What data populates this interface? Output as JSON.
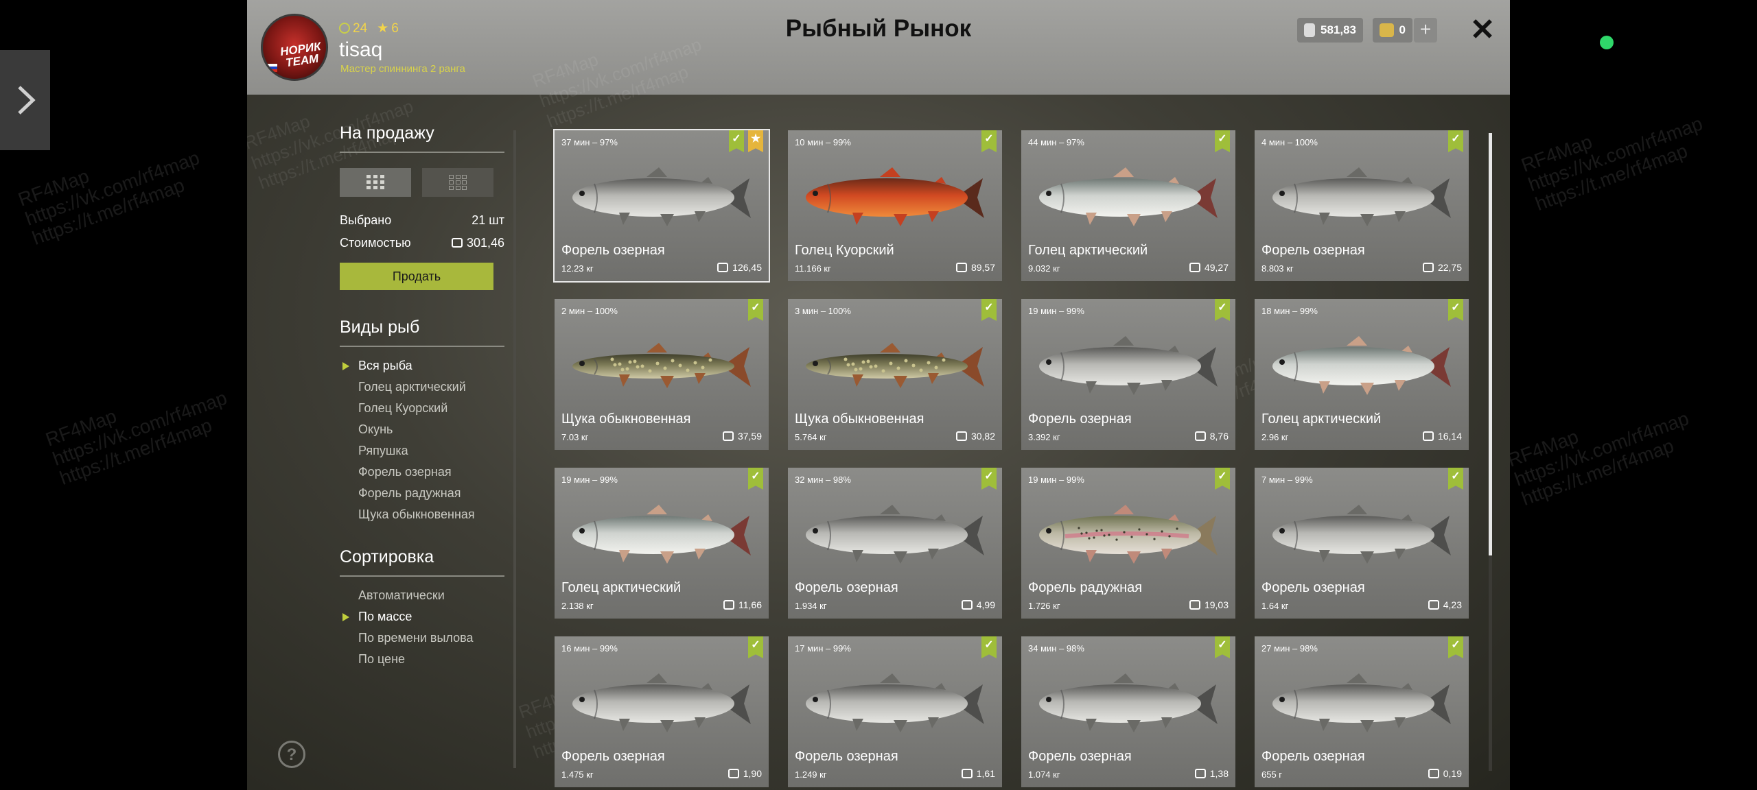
{
  "header": {
    "title": "Рыбный Рынок",
    "avatar_logo": "НОРИК TEAM",
    "stats": {
      "level": "24",
      "stars": "6"
    },
    "username": "tisaq",
    "rank": "Мастер спиннинга 2 ранга",
    "currency_silver": "581,83",
    "currency_gold": "0",
    "plus_label": "+",
    "close_label": "✕"
  },
  "sale": {
    "title": "На продажу",
    "selected_label": "Выбрано",
    "selected_value": "21 шт",
    "cost_label": "Стоимостью",
    "cost_value": "301,46",
    "sell_button": "Продать"
  },
  "species": {
    "title": "Виды рыб",
    "items": [
      "Вся рыба",
      "Голец арктический",
      "Голец Куорский",
      "Окунь",
      "Ряпушка",
      "Форель озерная",
      "Форель радужная",
      "Щука обыкновенная"
    ],
    "active_index": 0
  },
  "sorting": {
    "title": "Сортировка",
    "items": [
      "Автоматически",
      "По массе",
      "По времени вылова",
      "По цене"
    ],
    "active_index": 1
  },
  "help_label": "?",
  "watermarks": [
    "RF4Map",
    "https://vk.com/rf4map",
    "https://t.me/rf4map"
  ],
  "fish_cards": [
    {
      "time": "37 мин – 97%",
      "name": "Форель озерная",
      "weight": "12.23 кг",
      "price": "126,45",
      "kind": "trout",
      "selected": true,
      "favorite": true
    },
    {
      "time": "10 мин – 99%",
      "name": "Голец Куорский",
      "weight": "11.166 кг",
      "price": "89,57",
      "kind": "char_red",
      "selected": false,
      "favorite": false
    },
    {
      "time": "44 мин – 97%",
      "name": "Голец арктический",
      "weight": "9.032 кг",
      "price": "49,27",
      "kind": "char_arctic",
      "selected": false,
      "favorite": false
    },
    {
      "time": "4 мин – 100%",
      "name": "Форель озерная",
      "weight": "8.803 кг",
      "price": "22,75",
      "kind": "trout",
      "selected": false,
      "favorite": false
    },
    {
      "time": "2 мин – 100%",
      "name": "Щука обыкновенная",
      "weight": "7.03 кг",
      "price": "37,59",
      "kind": "pike",
      "selected": false,
      "favorite": false
    },
    {
      "time": "3 мин – 100%",
      "name": "Щука обыкновенная",
      "weight": "5.764 кг",
      "price": "30,82",
      "kind": "pike",
      "selected": false,
      "favorite": false
    },
    {
      "time": "19 мин – 99%",
      "name": "Форель озерная",
      "weight": "3.392 кг",
      "price": "8,76",
      "kind": "trout",
      "selected": false,
      "favorite": false
    },
    {
      "time": "18 мин – 99%",
      "name": "Голец арктический",
      "weight": "2.96 кг",
      "price": "16,14",
      "kind": "char_arctic",
      "selected": false,
      "favorite": false
    },
    {
      "time": "19 мин – 99%",
      "name": "Голец арктический",
      "weight": "2.138 кг",
      "price": "11,66",
      "kind": "char_arctic",
      "selected": false,
      "favorite": false
    },
    {
      "time": "32 мин – 98%",
      "name": "Форель озерная",
      "weight": "1.934 кг",
      "price": "4,99",
      "kind": "trout",
      "selected": false,
      "favorite": false
    },
    {
      "time": "19 мин – 99%",
      "name": "Форель радужная",
      "weight": "1.726 кг",
      "price": "19,03",
      "kind": "rainbow",
      "selected": false,
      "favorite": false
    },
    {
      "time": "7 мин – 99%",
      "name": "Форель озерная",
      "weight": "1.64 кг",
      "price": "4,23",
      "kind": "trout",
      "selected": false,
      "favorite": false
    },
    {
      "time": "16 мин – 99%",
      "name": "Форель озерная",
      "weight": "1.475 кг",
      "price": "1,90",
      "kind": "trout",
      "selected": false,
      "favorite": false
    },
    {
      "time": "17 мин – 99%",
      "name": "Форель озерная",
      "weight": "1.249 кг",
      "price": "1,61",
      "kind": "trout",
      "selected": false,
      "favorite": false
    },
    {
      "time": "34 мин – 98%",
      "name": "Форель озерная",
      "weight": "1.074 кг",
      "price": "1,38",
      "kind": "trout",
      "selected": false,
      "favorite": false
    },
    {
      "time": "27 мин – 98%",
      "name": "Форель озерная",
      "weight": "655 г",
      "price": "0,19",
      "kind": "trout",
      "selected": false,
      "favorite": false
    }
  ]
}
